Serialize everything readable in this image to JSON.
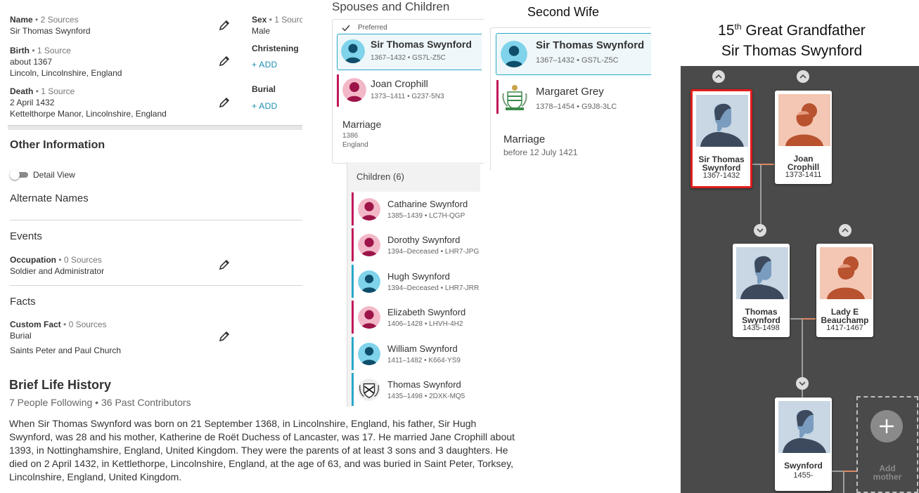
{
  "vitals": {
    "name": {
      "label": "Name",
      "sources": "• 2 Sources",
      "value": "Sir Thomas Swynford"
    },
    "birth": {
      "label": "Birth",
      "sources": "• 1 Source",
      "date": "about 1367",
      "place": "Lincoln, Lincolnshire, England"
    },
    "death": {
      "label": "Death",
      "sources": "• 1 Source",
      "date": "2 April 1432",
      "place": "Kettelthorpe Manor, Lincolnshire, England"
    },
    "sex": {
      "label": "Sex",
      "sources": "• 1 Sourc",
      "value": "Male"
    },
    "christening": {
      "label": "Christening",
      "add": "+ ADD"
    },
    "burial": {
      "label": "Burial",
      "add": "+ ADD"
    }
  },
  "other_info": {
    "title": "Other Information",
    "detail_view": "Detail View",
    "alternate_names": "Alternate Names",
    "events_title": "Events",
    "occupation": {
      "label": "Occupation",
      "sources": "• 0 Sources",
      "value": "Soldier and Administrator"
    },
    "facts_title": "Facts",
    "custom_fact": {
      "label": "Custom Fact",
      "sources": "• 0 Sources",
      "value": "Burial",
      "detail": "Saints Peter and Paul Church"
    }
  },
  "life_history": {
    "title": "Brief Life History",
    "following": "7 People Following • 36 Past Contributors",
    "text": "When Sir Thomas Swynford was born on 21 September 1368, in Lincolnshire, England, his father, Sir Hugh Swynford, was 28 and his mother, Katherine de Roët Duchess of Lancaster, was 17. He married Jane Crophill about 1393, in Nottinghamshire, England, United Kingdom. They were the parents of at least 3 sons and 3 daughters. He died on 2 April 1432, in Kettlethorpe, Lincolnshire, England, at the age of 63, and was buried in Saint Peter, Torksey, Lincolnshire, England, United Kingdom."
  },
  "spouses": {
    "title": "Spouses and Children",
    "preferred": "Preferred",
    "husband": {
      "name": "Sir Thomas Swynford",
      "meta": "1367–1432 • GS7L-Z5C"
    },
    "wife": {
      "name": "Joan Crophill",
      "meta": "1373–1411 • G237-5N3"
    },
    "marriage": {
      "label": "Marriage",
      "year": "1386",
      "place": "England"
    },
    "children_title": "Children (6)",
    "children": [
      {
        "name": "Catharine Swynford",
        "meta": "1385–1439 • LC7H-QGP",
        "sex": "female"
      },
      {
        "name": "Dorothy Swynford",
        "meta": "1394–Deceased • LHR7-JPG",
        "sex": "female"
      },
      {
        "name": "Hugh Swynford",
        "meta": "1394–Deceased • LHR7-JRR",
        "sex": "male"
      },
      {
        "name": "Elizabeth Swynford",
        "meta": "1406–1428 • LHVH-4H2",
        "sex": "female"
      },
      {
        "name": "William Swynford",
        "meta": "1411–1482 • K664-YS9",
        "sex": "male"
      },
      {
        "name": "Thomas Swynford",
        "meta": "1435–1498 • 2DXK-MQ5",
        "sex": "male-crest"
      }
    ]
  },
  "second_wife": {
    "title": "Second Wife",
    "husband": {
      "name": "Sir Thomas Swynford",
      "meta": "1367–1432 • GS7L-Z5C"
    },
    "wife": {
      "name": "Margaret Grey",
      "meta": "1378–1454 • G9J8-3LC"
    },
    "marriage": {
      "label": "Marriage",
      "date": "before 12 July 1421"
    }
  },
  "tree": {
    "title_line1": "15",
    "title_sup": "th",
    "title_line1_rest": " Great Grandfather",
    "title_line2": "Sir Thomas Swynford",
    "cards": [
      {
        "name1": "Sir Thomas",
        "name2": "Swynford",
        "dates": "1367-1432",
        "sex": "male"
      },
      {
        "name1": "Joan",
        "name2": "Crophill",
        "dates": "1373-1411",
        "sex": "female"
      },
      {
        "name1": "Thomas",
        "name2": "Swynford",
        "dates": "1435-1498",
        "sex": "male"
      },
      {
        "name1": "Lady E",
        "name2": "Beauchamp",
        "dates": "1417-1467",
        "sex": "female"
      },
      {
        "name1": "Swynford",
        "name2": "",
        "dates": "1455-",
        "sex": "male"
      }
    ],
    "add_mother1": "Add",
    "add_mother2": "mother"
  },
  "colors": {
    "female": "#c2185b",
    "male": "#2aa7c9",
    "link": "#1a8db0",
    "tree_bg": "#4a4a4a",
    "highlight": "#e11d1d"
  },
  "icons": [
    "edit-pencil-icon",
    "checkmark-icon",
    "chevron-up-icon",
    "chevron-down-icon",
    "plus-icon",
    "male-avatar-icon",
    "female-avatar-icon",
    "coat-of-arms-icon",
    "toggle-switch"
  ]
}
